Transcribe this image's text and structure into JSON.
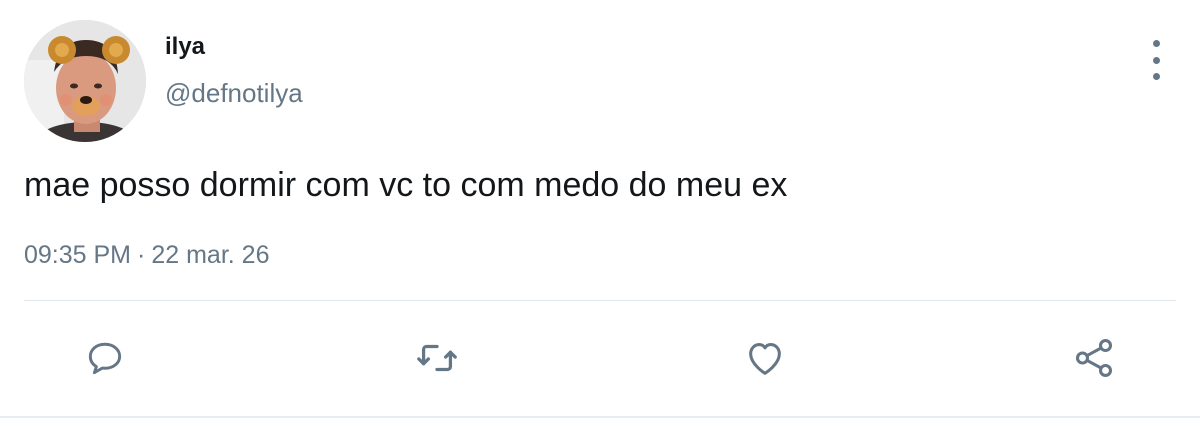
{
  "author": {
    "display_name": "ilya",
    "handle": "@defnotilya"
  },
  "tweet": {
    "text": "mae posso dormir com vc to com medo do meu ex",
    "time": "09:35 PM",
    "separator": "·",
    "date": "22 mar. 26"
  },
  "actions": [
    {
      "name": "reply",
      "icon": "reply-icon"
    },
    {
      "name": "retweet",
      "icon": "retweet-icon"
    },
    {
      "name": "like",
      "icon": "heart-icon"
    },
    {
      "name": "share",
      "icon": "share-icon"
    }
  ],
  "colors": {
    "text": "#14171a",
    "secondary": "#657786",
    "divider": "#e1e8ed",
    "background": "#ffffff"
  }
}
